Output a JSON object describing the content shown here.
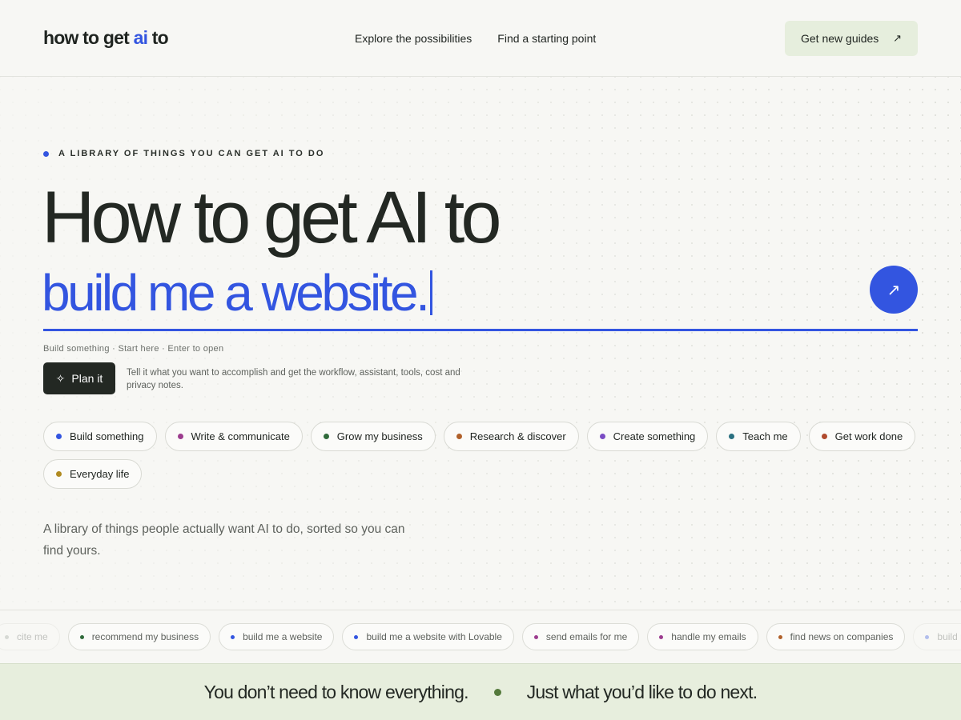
{
  "header": {
    "logo": {
      "part1": "how to get ",
      "accent": "ai",
      "part2": " to"
    },
    "nav": [
      {
        "label": "Explore the possibilities"
      },
      {
        "label": "Find a starting point"
      }
    ],
    "cta": {
      "label": "Get new guides",
      "icon": "arrow-up-right-icon"
    }
  },
  "hero": {
    "eyebrow": "A library of things you can get AI to do",
    "headline": "How to get AI to",
    "typed_text": "build me a website.",
    "hint": "Build something · Start here · Enter to open",
    "plan_button": {
      "label": "Plan it",
      "icon": "sparkle-icon"
    },
    "plan_description": "Tell it what you want to accomplish and get the workflow, assistant, tools, cost and privacy notes.",
    "go_button_icon": "arrow-up-right-icon",
    "tagline": "A library of things people actually want AI to do, sorted so you can find yours."
  },
  "categories": [
    {
      "label": "Build something",
      "color": "#3355e0"
    },
    {
      "label": "Write & communicate",
      "color": "#9c3c8e"
    },
    {
      "label": "Grow my business",
      "color": "#2f6a3a"
    },
    {
      "label": "Research & discover",
      "color": "#b0602a"
    },
    {
      "label": "Create something",
      "color": "#7a4cc4"
    },
    {
      "label": "Teach me",
      "color": "#2a7080"
    },
    {
      "label": "Get work done",
      "color": "#b04a2e"
    },
    {
      "label": "Everyday life",
      "color": "#b08a20"
    }
  ],
  "marquee": [
    {
      "label": "cite me",
      "color": "#9aa39a",
      "faded": true
    },
    {
      "label": "recommend my business",
      "color": "#2f6a3a"
    },
    {
      "label": "build me a website",
      "color": "#3355e0"
    },
    {
      "label": "build me a website with Lovable",
      "color": "#3355e0"
    },
    {
      "label": "send emails for me",
      "color": "#9c3c8e"
    },
    {
      "label": "handle my emails",
      "color": "#9c3c8e"
    },
    {
      "label": "find news on companies",
      "color": "#b0602a"
    },
    {
      "label": "build me a w",
      "color": "#3355e0",
      "faded": true
    }
  ],
  "band": {
    "left": "You don’t need to know everything.",
    "right": "Just what you’d like to do next.",
    "dot_color": "#557a3c"
  }
}
